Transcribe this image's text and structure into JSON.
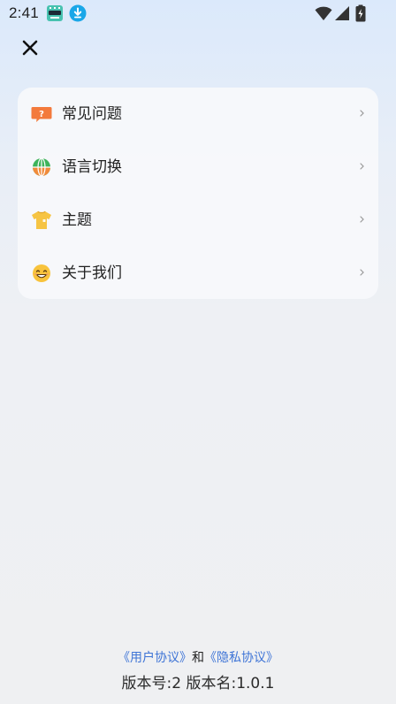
{
  "status_bar": {
    "time": "2:41",
    "icons": [
      "app-notification-icon",
      "download-icon",
      "wifi-icon",
      "cell-signal-icon",
      "battery-charging-icon"
    ]
  },
  "header": {
    "close_icon": "close-icon"
  },
  "menu": {
    "items": [
      {
        "label": "常见问题",
        "icon": "question-bubble-icon"
      },
      {
        "label": "语言切换",
        "icon": "globe-icon"
      },
      {
        "label": "主题",
        "icon": "tshirt-icon"
      },
      {
        "label": "关于我们",
        "icon": "smiley-face-icon"
      }
    ]
  },
  "footer": {
    "user_agreement": "《用户协议》",
    "conjunction": "和",
    "privacy_policy": "《隐私协议》",
    "version_text": "版本号:2 版本名:1.0.1"
  },
  "colors": {
    "link": "#3e74d6",
    "download_badge": "#1aa7e8",
    "question_icon": "#f37a3c",
    "globe_green": "#3db35a",
    "globe_orange": "#f18a3a",
    "tshirt": "#f6c443",
    "smiley": "#f8c33c"
  }
}
